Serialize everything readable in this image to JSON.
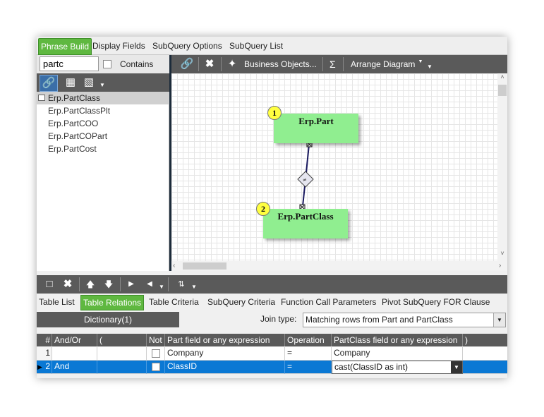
{
  "main_tabs": [
    {
      "label": "Phrase Build",
      "active": true
    },
    {
      "label": "Display Fields",
      "active": false
    },
    {
      "label": "SubQuery Options",
      "active": false
    },
    {
      "label": "SubQuery List",
      "active": false
    }
  ],
  "search": {
    "value": "partc",
    "contains_label": "Contains"
  },
  "tables": [
    "Erp.PartClass",
    "Erp.PartClassPlt",
    "Erp.PartCOO",
    "Erp.PartCOPart",
    "Erp.PartCost"
  ],
  "diagram_toolbar": {
    "business_objects": "Business Objects...",
    "sigma": "Σ",
    "arrange": "Arrange Diagram"
  },
  "diagram": {
    "entities": [
      {
        "badge": "1",
        "name": "Erp.Part"
      },
      {
        "badge": "2",
        "name": "Erp.PartClass"
      }
    ]
  },
  "sub_tabs": [
    {
      "label": "Table List",
      "active": false
    },
    {
      "label": "Table Relations",
      "active": true
    },
    {
      "label": "Table Criteria",
      "active": false
    },
    {
      "label": "SubQuery Criteria",
      "active": false
    },
    {
      "label": "Function Call Parameters",
      "active": false
    },
    {
      "label": "Pivot SubQuery FOR Clause",
      "active": false
    }
  ],
  "relations": {
    "dictionary_label": "Dictionary(1)",
    "join_label": "Join type:",
    "join_value": "Matching rows from Part and PartClass",
    "columns": [
      "#",
      "And/Or",
      "(",
      "Not",
      "Part field or any expression",
      "Operation",
      "PartClass field or any expression",
      ")"
    ],
    "rows": [
      {
        "num": "1",
        "andor": "",
        "paren_open": "",
        "part_field": "Company",
        "operation": "=",
        "partclass_field": "Company",
        "paren_close": ""
      },
      {
        "num": "2",
        "andor": "And",
        "paren_open": "",
        "part_field": "ClassID",
        "operation": "=",
        "partclass_field": "cast(ClassID as int)",
        "paren_close": ""
      }
    ]
  },
  "colors": {
    "accent_green": "#5fb840",
    "entity_fill": "#90ee90",
    "selection_blue": "#0a78d4",
    "toolbar_gray": "#5a5a5a"
  }
}
